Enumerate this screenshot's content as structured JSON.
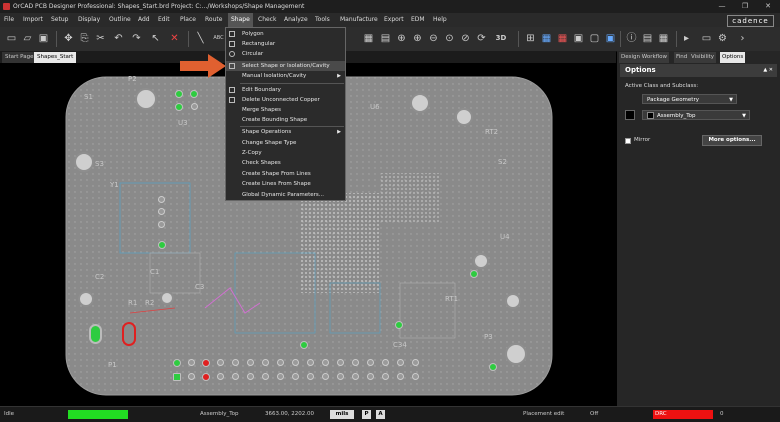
{
  "window": {
    "title": "OrCAD PCB Designer Professional: Shapes_Start.brd  Project: C:.../Workshops/Shape Management",
    "controls": [
      "—",
      "❐",
      "✕"
    ]
  },
  "menubar": {
    "items": [
      "File",
      "Import",
      "Setup",
      "Display",
      "Outline",
      "Add",
      "Edit",
      "Place",
      "Route",
      "Shape",
      "Check",
      "Analyze",
      "Tools",
      "Manufacture",
      "Export",
      "EDM",
      "Help"
    ],
    "active": "Shape",
    "brand": "cadence"
  },
  "tabs": [
    "Start Page",
    "Shapes_Start"
  ],
  "shape_menu": {
    "items": [
      {
        "label": "Polygon"
      },
      {
        "label": "Rectangular"
      },
      {
        "label": "Circular"
      },
      {
        "label": "Select Shape or Isolation/Cavity",
        "highlighted": true
      },
      {
        "label": "Manual Isolation/Cavity",
        "submenu": true
      },
      {
        "label": "Edit Boundary"
      },
      {
        "label": "Delete Unconnected Copper"
      },
      {
        "label": "Merge Shapes"
      },
      {
        "label": "Create Bounding Shape"
      },
      {
        "label": "Shape Operations",
        "submenu": true
      },
      {
        "label": "Change Shape Type"
      },
      {
        "label": "Z-Copy"
      },
      {
        "label": "Check Shapes"
      },
      {
        "label": "Create Shape From Lines"
      },
      {
        "label": "Create Lines From Shape"
      },
      {
        "label": "Global Dynamic Parameters..."
      }
    ]
  },
  "panel": {
    "tabs": [
      "Design Workflow",
      "Find",
      "Visibility",
      "Options"
    ],
    "active_tab": "Options",
    "title": "Options",
    "title_controls": "▲ ✕",
    "class_label": "Active Class and Subclass:",
    "class_value": "Package Geometry",
    "subclass_value": "Assembly_Top",
    "mirror_label": "Mirror",
    "more_options_label": "More options..."
  },
  "toolbar": {
    "icons": [
      "new-file-icon",
      "open-folder-icon",
      "save-icon",
      "cut-icon",
      "copy-icon",
      "move-icon",
      "undo-icon",
      "redo-icon",
      "select-icon",
      "delete-icon",
      "add-line-icon",
      "text-icon",
      "zoom-fit-icon",
      "zoom-in-icon",
      "zoom-out-icon",
      "zoom-world-icon",
      "refresh-icon",
      "3d-view-icon",
      "grid-icon",
      "layers-icon",
      "info-icon",
      "list-icon",
      "play-icon",
      "settings-icon"
    ],
    "label_3d": "3D"
  },
  "board": {
    "silkscreen": [
      "P1",
      "P2",
      "P3",
      "S1",
      "S2",
      "S3",
      "U3",
      "U4",
      "U6",
      "C1",
      "C2",
      "C3",
      "C34",
      "RT1",
      "RT2",
      "Y1",
      "R1",
      "R2"
    ]
  },
  "status": {
    "mode": "Idle",
    "subclass": "Assembly_Top",
    "coords": "3663.00, 2202.00",
    "units": "mils",
    "p_button": "P",
    "a_button": "A",
    "placement": "Placement edit",
    "off": "Off",
    "drc_label": "DRC",
    "drc_count": "0"
  },
  "colors": {
    "board": "#8a8a8a",
    "accent_arrow": "#e06030",
    "status_green": "#22dd22",
    "status_red": "#ee1111",
    "pad_green": "#2ecc40",
    "pad_red": "#e02020"
  }
}
